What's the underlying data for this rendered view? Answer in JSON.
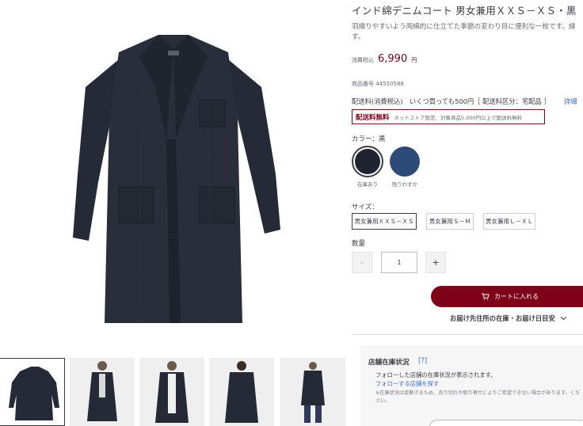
{
  "product": {
    "title": "インド綿デニムコート 男女兼用ＸＸＳ－ＸＳ・黒",
    "description": "羽織りやすいよう両綿的に仕立てた季節の変わり目に便利な一枚です。縁す。",
    "price_label": "消費税込",
    "price": "6,990",
    "price_unit": "円",
    "product_no": "商品番号 44550588"
  },
  "shipping": {
    "text": "配送料(消費税込)　いくつ買っても500円［ 配送料区分：宅配品 ］",
    "detail_link": "詳細",
    "free_title": "配送料無料",
    "free_note": "ネットストア限定、対象商品5,000円以上で配送料無料"
  },
  "color": {
    "label": "カラー：黒",
    "options": [
      {
        "caption": "在庫あり",
        "color": "#1f2430",
        "selected": true
      },
      {
        "caption": "残りわずか",
        "color": "#2e4a78",
        "selected": false
      }
    ]
  },
  "size": {
    "label": "サイズ：",
    "options": [
      {
        "label": "男女兼用ＸＸＳ－ＸＳ",
        "selected": true
      },
      {
        "label": "男女兼用Ｓ－Ｍ",
        "selected": false
      },
      {
        "label": "男女兼用Ｌ－ＸＬ",
        "selected": false
      }
    ]
  },
  "quantity": {
    "label": "数量",
    "minus": "-",
    "plus": "+",
    "value": "1"
  },
  "actions": {
    "cart_label": "カートに入れる",
    "store_link": "お届け先住所の在庫・お届け日目安"
  },
  "store": {
    "title": "店舗在庫状況",
    "help": "[?]",
    "line1": "フォローした店舗の在庫状況が表示されます。",
    "line2": "フォローする店舗を探す",
    "note": "※在庫状況は変動するため、売り切れや取り寄せによりご希望できない場合があります。ください。"
  },
  "colors": {
    "accent": "#7f0019",
    "link": "#3a6fc9",
    "coat": "#262a36"
  }
}
